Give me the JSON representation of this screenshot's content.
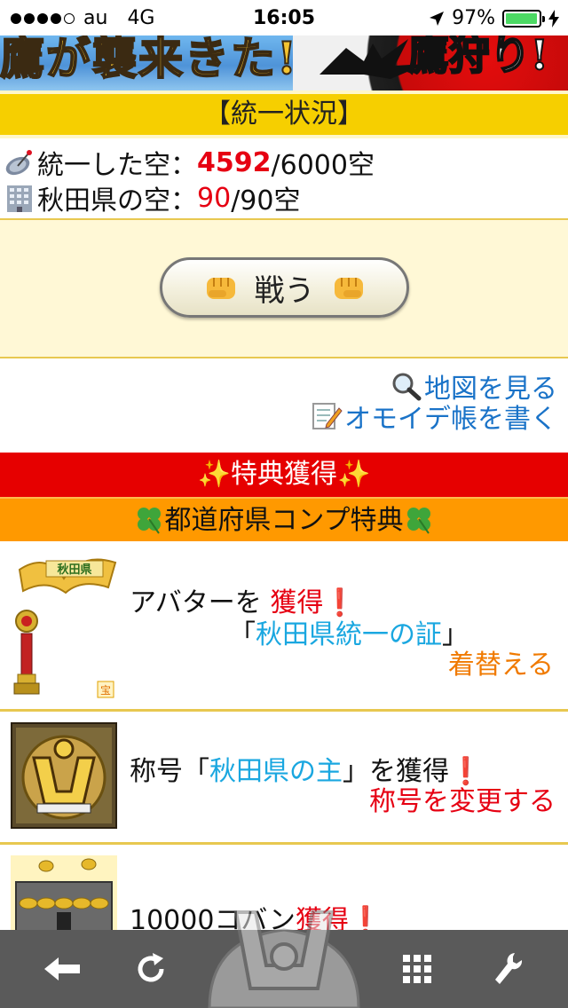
{
  "status_bar": {
    "carrier": "au",
    "network": "4G",
    "time": "16:05",
    "battery": "97%",
    "battery_level": 0.97
  },
  "banner": {
    "left_text": "鷹が襲来きた!",
    "right_text": "鷹狩り!"
  },
  "unification": {
    "header": "【統一状況】",
    "sky_label": "統一した空：",
    "sky_current": "4592",
    "sky_total": "/6000空",
    "pref_label": "秋田県の空：",
    "pref_current": "90",
    "pref_total": "/90空"
  },
  "fight_button": {
    "label": "戦う"
  },
  "links": {
    "map": "地図を見る",
    "memo": "オモイデ帳を書く"
  },
  "bonus": {
    "header": "✨特典獲得✨",
    "subheader": "都道府県コンプ特典"
  },
  "rewards": {
    "avatar": {
      "line1_prefix": "アバターを",
      "line1_highlight": "獲得",
      "line2_open": "「",
      "line2_name": "秋田県統一の証",
      "line2_close": "」",
      "action": "着替える",
      "thumb_banner": "秋田県",
      "thumb_badge": "宝"
    },
    "title": {
      "prefix": "称号「",
      "name": "秋田県の主",
      "suffix": "」を獲得",
      "action": "称号を変更する"
    },
    "koban": {
      "amount": "10000",
      "unit": "コバン",
      "highlight": "獲得"
    }
  },
  "toolbar": {
    "back": "back-icon",
    "reload": "reload-icon",
    "menu": "grid-icon",
    "settings": "wrench-icon"
  }
}
